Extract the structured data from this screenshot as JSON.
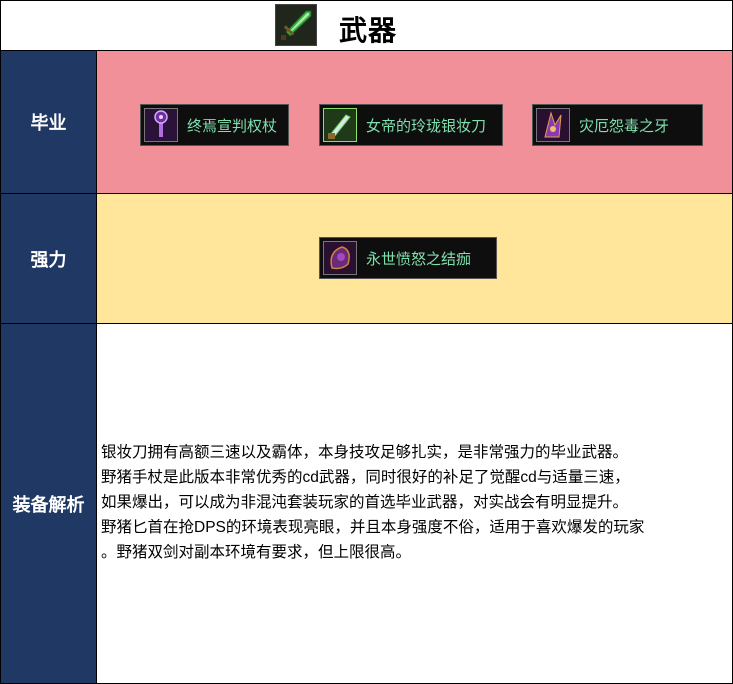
{
  "header": {
    "title": "武器",
    "icon": "green-sword-icon"
  },
  "rows": {
    "graduation": {
      "label": "毕业",
      "items": [
        {
          "name": "终焉宣判权杖",
          "icon": "purple-scepter-icon"
        },
        {
          "name": "女帝的玲珑银妆刀",
          "icon": "green-silver-blade-icon"
        },
        {
          "name": "灾厄怨毒之牙",
          "icon": "purple-fang-icon"
        }
      ]
    },
    "strong": {
      "label": "强力",
      "items": [
        {
          "name": "永世愤怒之结痂",
          "icon": "purple-scab-icon"
        }
      ]
    },
    "analysis": {
      "label": "装备解析",
      "lines": [
        "银妆刀拥有高额三速以及霸体，本身技攻足够扎实，是非常强力的毕业武器。",
        "野猪手杖是此版本非常优秀的cd武器，同时很好的补足了觉醒cd与适量三速，",
        "如果爆出，可以成为非混沌套装玩家的首选毕业武器，对实战会有明显提升。",
        "野猪匕首在抢DPS的环境表现亮眼，并且本身强度不俗，适用于喜欢爆发的玩家",
        "。野猪双剑对副本环境有要求，但上限很高。"
      ]
    }
  },
  "colors": {
    "label_bg": "#1f3864",
    "graduation_bg": "#f19099",
    "strong_bg": "#ffe69a",
    "item_text": "#7fe0ad",
    "item_bg": "#0e0e0e"
  }
}
